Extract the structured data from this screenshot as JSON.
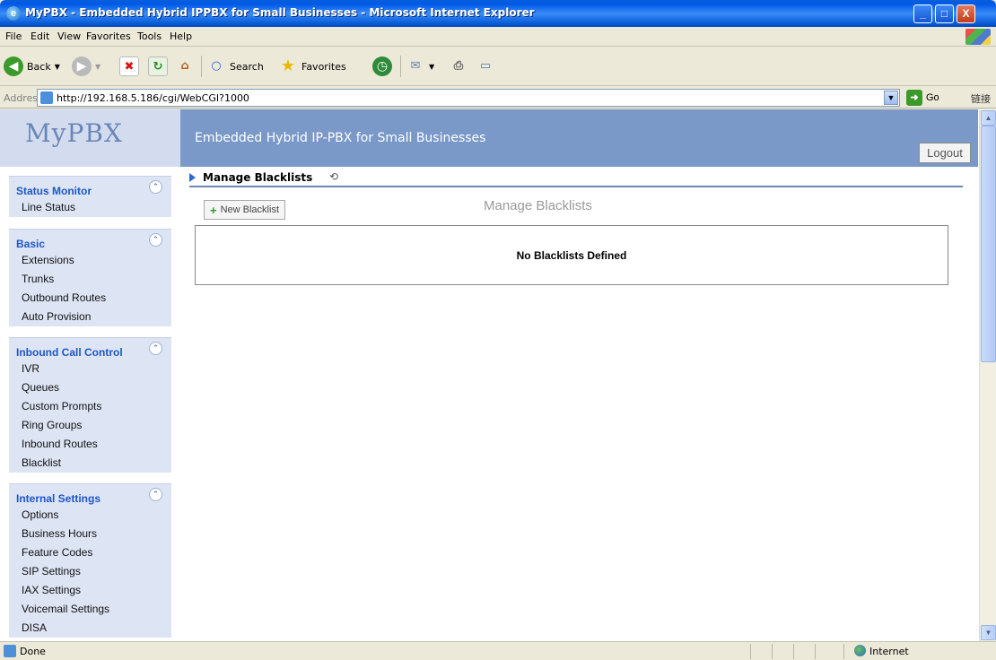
{
  "window": {
    "title": "MyPBX - Embedded Hybrid IPPBX for Small Businesses - Microsoft Internet Explorer",
    "buttons": [
      "_",
      "□",
      "X"
    ]
  },
  "menu": [
    "File",
    "Edit",
    "View",
    "Favorites",
    "Tools",
    "Help"
  ],
  "toolbar": {
    "back": "Back",
    "search": "Search",
    "favorites": "Favorites"
  },
  "address": {
    "label": "Address",
    "url": "http://192.168.5.186/cgi/WebCGI?1000",
    "go": "Go",
    "links": "链接"
  },
  "header": {
    "logo": "MyPBX",
    "tagline": "Embedded Hybrid IP-PBX for Small Businesses",
    "logout": "Logout"
  },
  "sidebar": {
    "sections": [
      {
        "title": "Status Monitor",
        "items": [
          "Line Status"
        ]
      },
      {
        "title": "Basic",
        "items": [
          "Extensions",
          "Trunks",
          "Outbound Routes",
          "Auto Provision"
        ]
      },
      {
        "title": "Inbound Call Control",
        "items": [
          "IVR",
          "Queues",
          "Custom Prompts",
          "Ring Groups",
          "Inbound Routes",
          "Blacklist"
        ]
      },
      {
        "title": "Internal Settings",
        "items": [
          "Options",
          "Business Hours",
          "Feature Codes",
          "SIP Settings",
          "IAX Settings",
          "Voicemail Settings",
          "DISA"
        ]
      }
    ]
  },
  "main": {
    "breadcrumb": "Manage Blacklists",
    "new_button": "New Blacklist",
    "page_title": "Manage Blacklists",
    "empty_message": "No Blacklists Defined"
  },
  "status": {
    "text": "Done",
    "zone": "Internet"
  }
}
